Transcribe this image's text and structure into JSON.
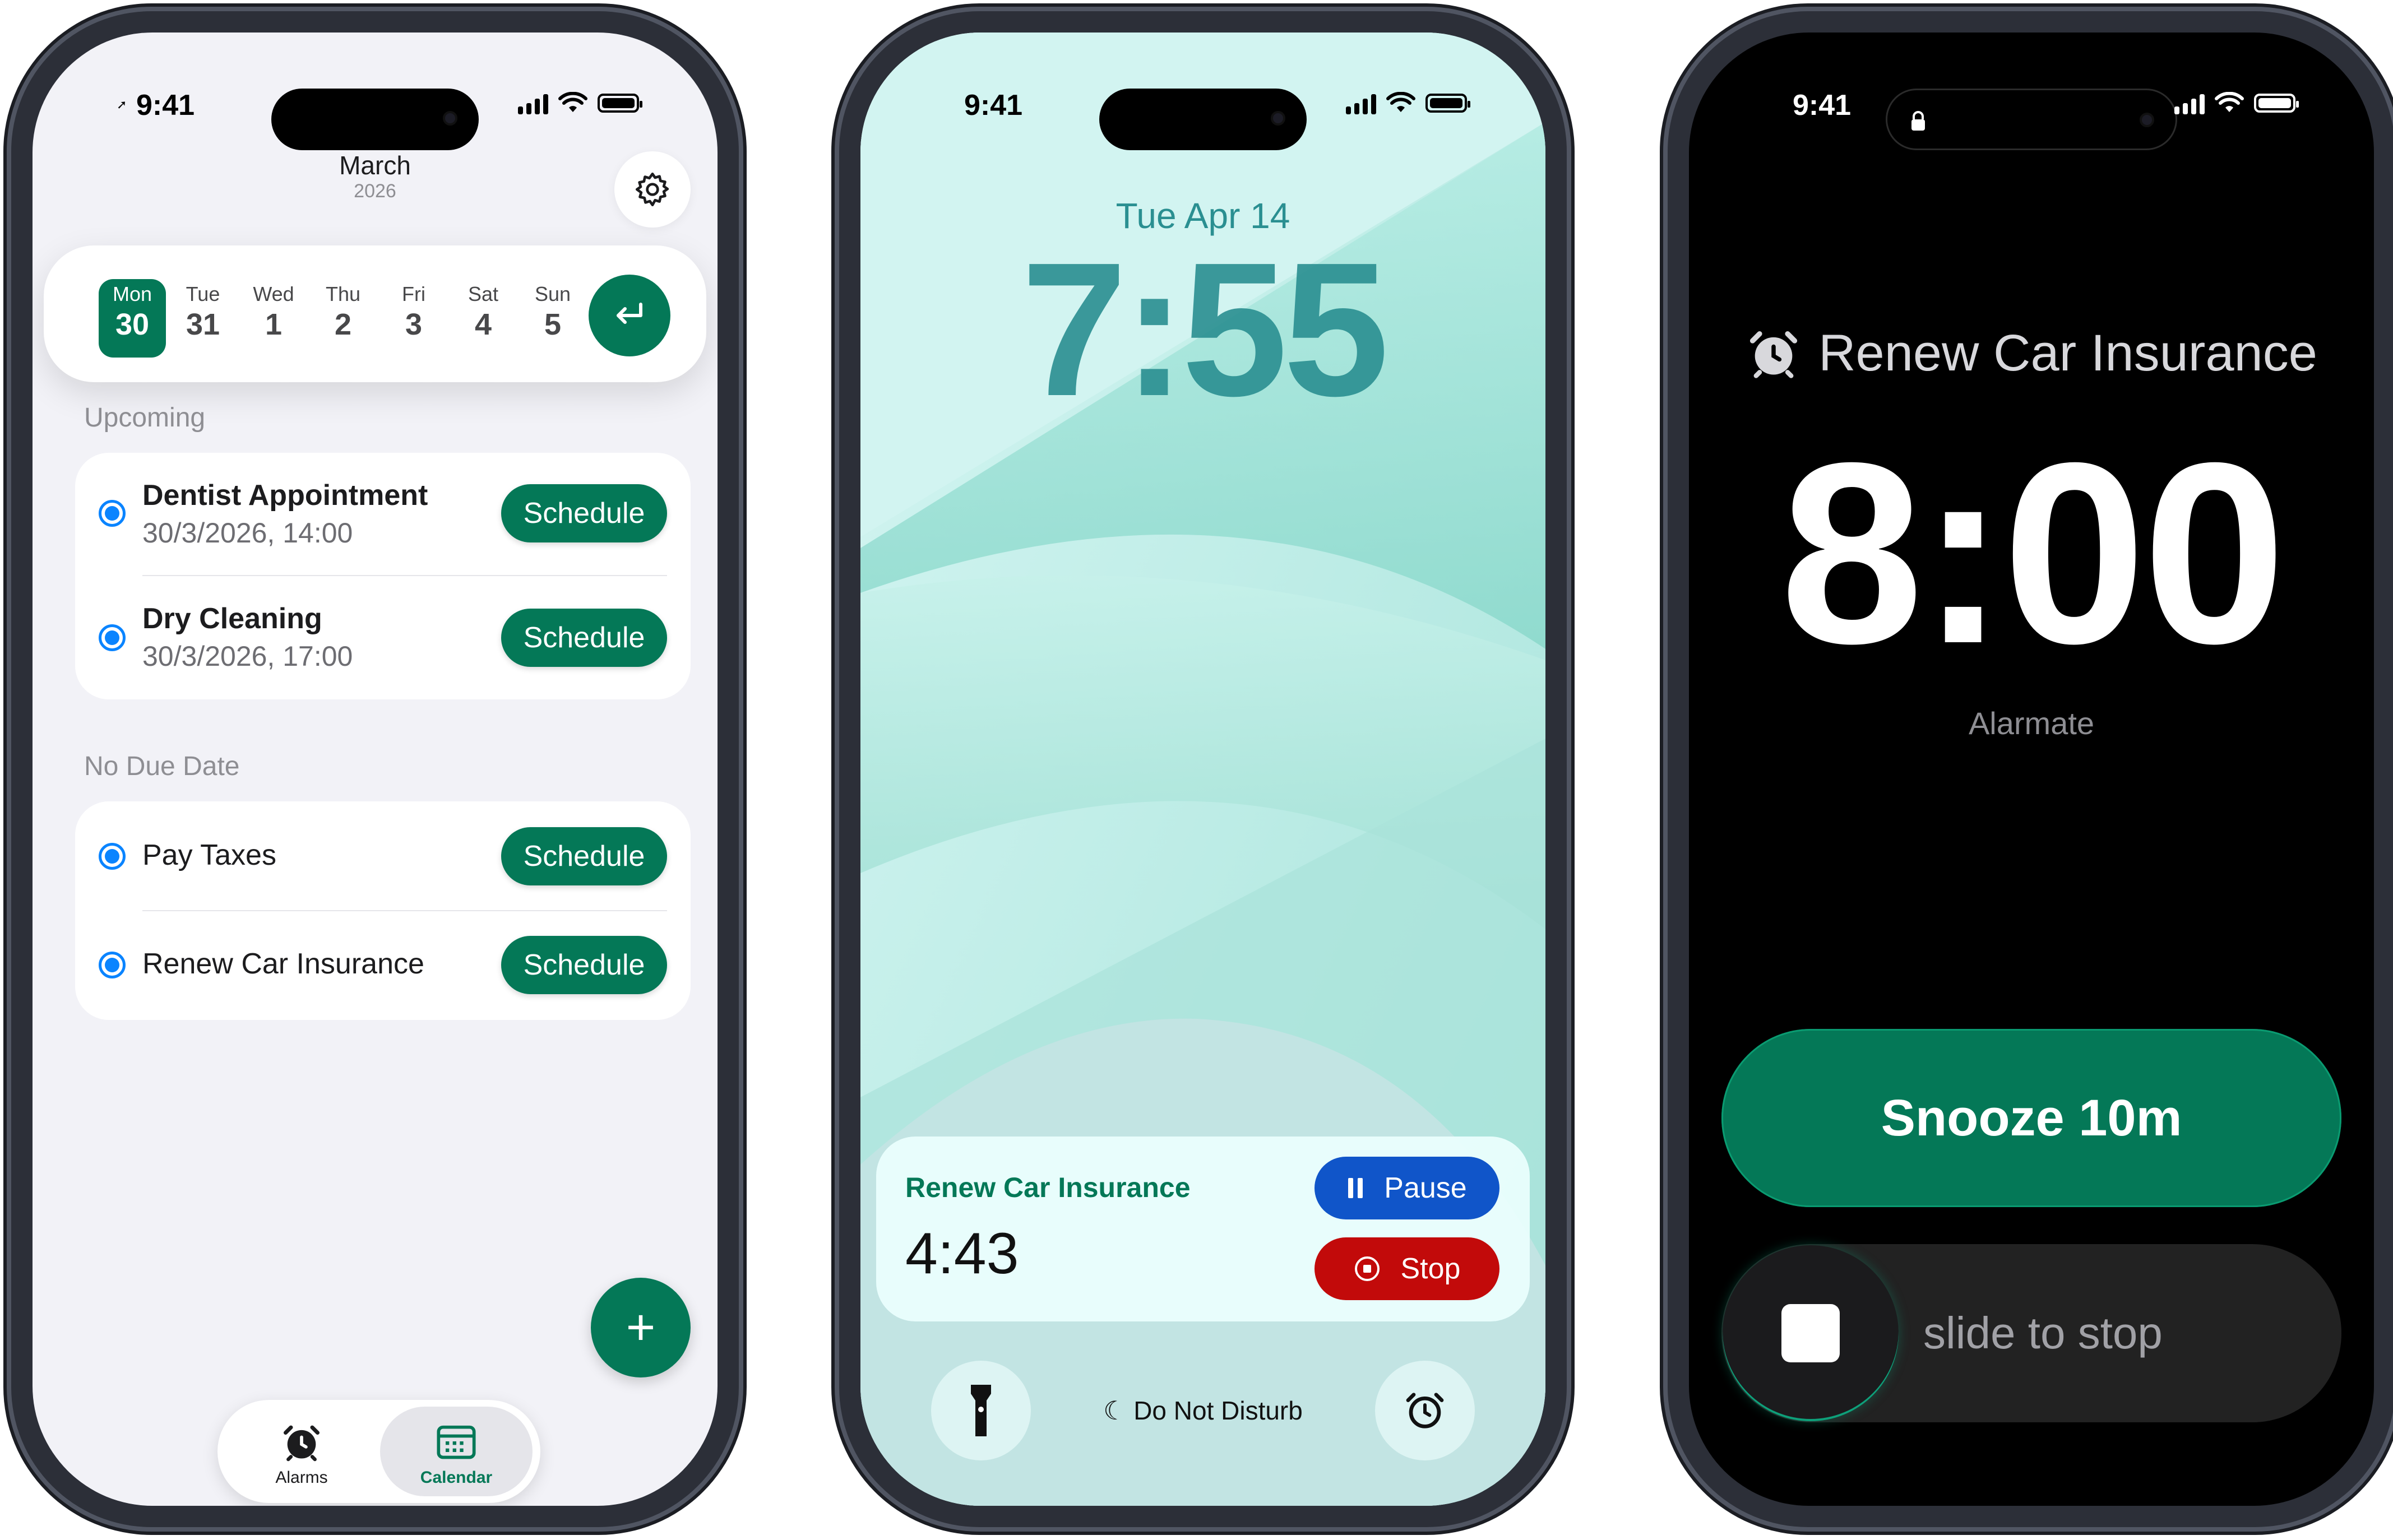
{
  "status": {
    "time": "9:41"
  },
  "app": {
    "header": {
      "month": "March",
      "year": "2026"
    },
    "week": {
      "days": [
        {
          "name": "Mon",
          "num": "30",
          "selected": true
        },
        {
          "name": "Tue",
          "num": "31"
        },
        {
          "name": "Wed",
          "num": "1"
        },
        {
          "name": "Thu",
          "num": "2"
        },
        {
          "name": "Fri",
          "num": "3"
        },
        {
          "name": "Sat",
          "num": "4"
        },
        {
          "name": "Sun",
          "num": "5"
        }
      ]
    },
    "sections": [
      {
        "title": "Upcoming",
        "items": [
          {
            "title": "Dentist Appointment",
            "subtitle": "30/3/2026, 14:00",
            "action": "Schedule"
          },
          {
            "title": "Dry Cleaning",
            "subtitle": "30/3/2026, 17:00",
            "action": "Schedule"
          }
        ]
      },
      {
        "title": "No Due Date",
        "items": [
          {
            "title": "Pay Taxes",
            "action": "Schedule"
          },
          {
            "title": "Renew Car Insurance",
            "action": "Schedule"
          }
        ]
      }
    ],
    "fab": "+",
    "tabs": [
      {
        "label": "Alarms",
        "icon": "alarm-clock-icon"
      },
      {
        "label": "Calendar",
        "icon": "calendar-icon",
        "active": true
      }
    ],
    "accent": "#047857"
  },
  "lockscreen": {
    "date": "Tue Apr 14",
    "time": "7:55",
    "activity": {
      "title": "Renew Car Insurance",
      "countdown": "4:43",
      "pause": "Pause",
      "stop": "Stop"
    },
    "focus": "Do Not Disturb",
    "left_button_icon": "flashlight-icon",
    "right_button_icon": "alarm-clock-icon"
  },
  "alarm": {
    "title": "Renew Car Insurance",
    "time": "8:00",
    "app_name": "Alarmate",
    "snooze": "Snooze 10m",
    "slide": "slide to stop"
  }
}
